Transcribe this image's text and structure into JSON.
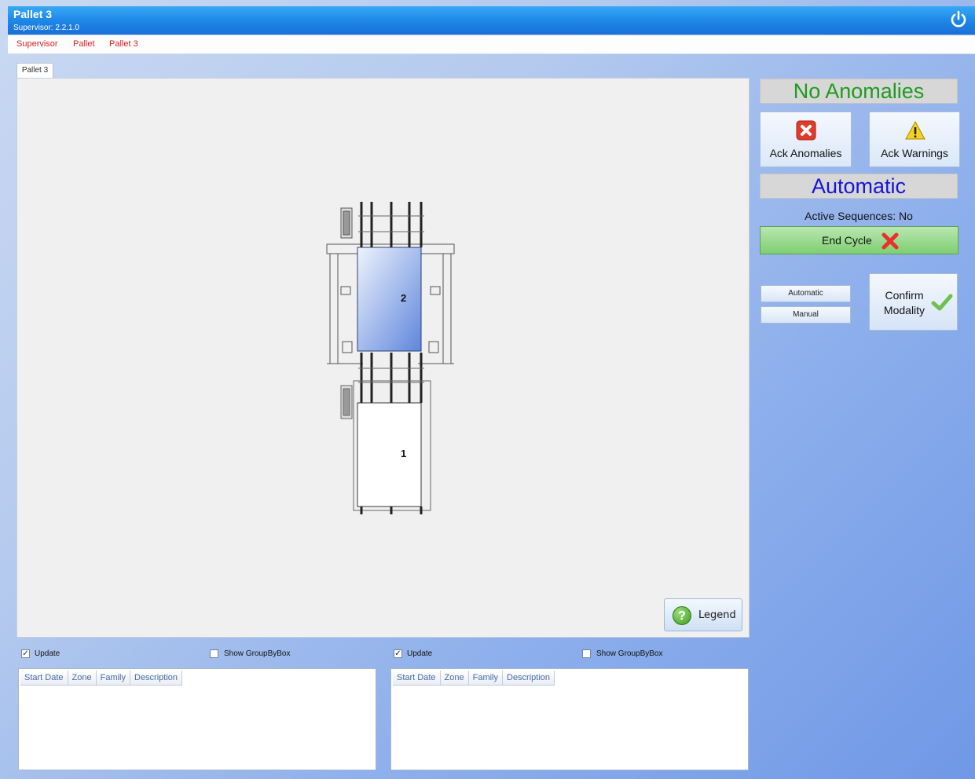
{
  "window": {
    "title": "Pallet 3",
    "subtitle": "Supervisor: 2.2.1.0"
  },
  "breadcrumb": [
    "Supervisor",
    "Pallet",
    "Pallet 3"
  ],
  "tab": {
    "label": "Pallet 3"
  },
  "machine": {
    "pallet_top_label": "2",
    "pallet_bottom_label": "1"
  },
  "legend": {
    "label": "Legend",
    "icon": "help-icon"
  },
  "status": {
    "anomalies": "No Anomalies",
    "anomalies_color": "#1f9b1f",
    "mode": "Automatic",
    "mode_color": "#1515d8",
    "active_sequences": "Active Sequences:  No"
  },
  "buttons": {
    "ack_anomalies": "Ack Anomalies",
    "ack_warnings": "Ack Warnings",
    "end_cycle": "End Cycle",
    "automatic": "Automatic",
    "manual": "Manual",
    "confirm_line1": "Confirm",
    "confirm_line2": "Modality"
  },
  "bottom": {
    "left": {
      "update_label": "Update",
      "update_checked": true,
      "group_label": "Show GroupByBox",
      "group_checked": false
    },
    "right": {
      "update_label": "Update",
      "update_checked": true,
      "group_label": "Show GroupByBox",
      "group_checked": false
    },
    "columns": [
      "Start Date",
      "Zone",
      "Family",
      "Description"
    ]
  }
}
